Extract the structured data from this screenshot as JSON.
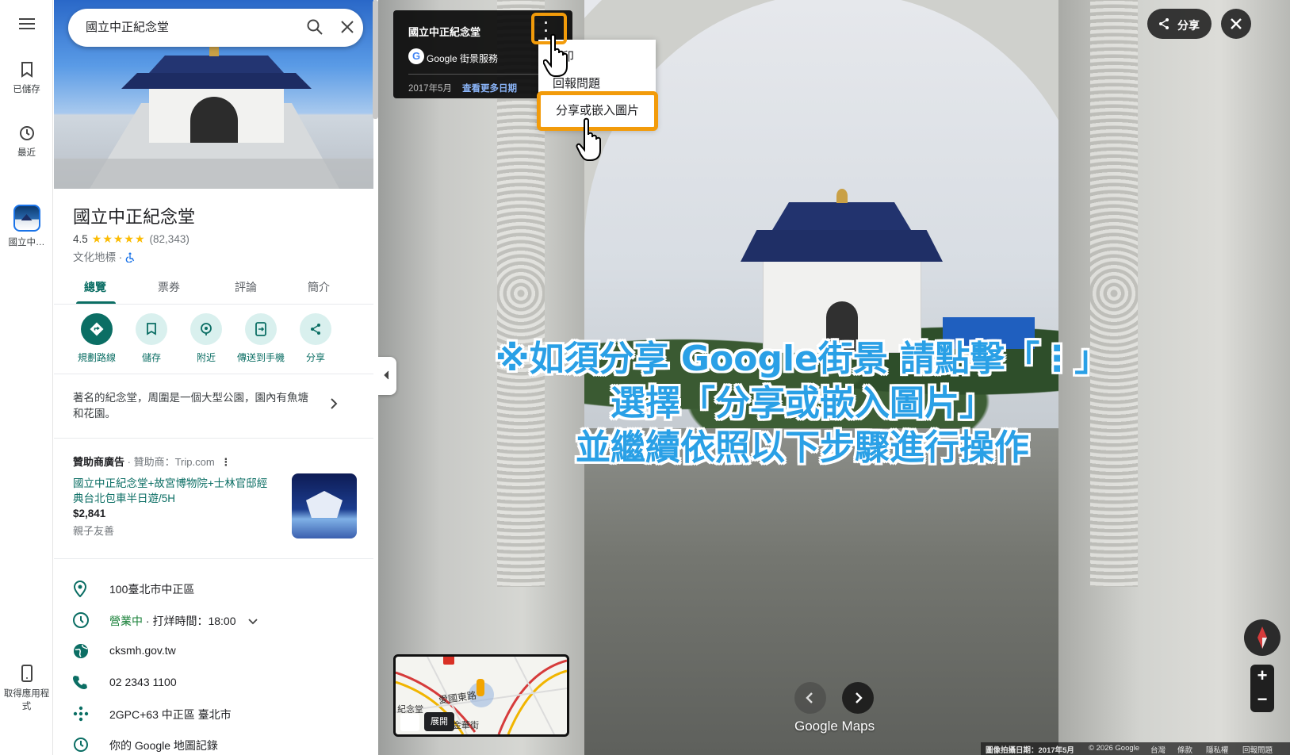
{
  "rail": {
    "menu_label": "",
    "saved_label": "已儲存",
    "recent_label": "最近",
    "place_label": "國立中…",
    "get_app_label": "取得應用程式"
  },
  "search": {
    "value": "國立中正紀念堂"
  },
  "place": {
    "title": "國立中正紀念堂",
    "rating": "4.5",
    "stars": "★★★★★",
    "review_count": "(82,343)",
    "category": "文化地標 · ",
    "accessible_icon": "wheelchair-icon"
  },
  "tabs": [
    {
      "label": "總覽",
      "active": true
    },
    {
      "label": "票券",
      "active": false
    },
    {
      "label": "評論",
      "active": false
    },
    {
      "label": "簡介",
      "active": false
    }
  ],
  "actions": [
    {
      "label": "規劃路線",
      "icon": "directions-icon"
    },
    {
      "label": "儲存",
      "icon": "bookmark-icon"
    },
    {
      "label": "附近",
      "icon": "nearby-icon"
    },
    {
      "label": "傳送到手機",
      "icon": "send-to-phone-icon"
    },
    {
      "label": "分享",
      "icon": "share-icon"
    }
  ],
  "description": "著名的紀念堂，周圍是一個大型公園，園內有魚塘和花園。",
  "sponsored": {
    "heading": "贊助商廣告",
    "sponsor": " · 贊助商：Trip.com",
    "title": "國立中正紀念堂+故宮博物院+士林官邸經典台北包車半日遊/5H",
    "price": "$2,841",
    "tag": "親子友善"
  },
  "info": {
    "address": "100臺北市中正區",
    "status_open": "營業中",
    "status_hours": " · 打烊時間：18:00",
    "website": "cksmh.gov.tw",
    "phone": "02 2343 1100",
    "plus_code": "2GPC+63 中正區 臺北市",
    "history": "你的 Google 地圖記錄"
  },
  "streetview": {
    "card_title": "國立中正紀念堂",
    "card_brand": "Google 街景服務",
    "card_date": "2017年5月",
    "card_more": "查看更多日期",
    "menu_item_1": "印",
    "menu_item_2": "回報問題",
    "menu_item_3": "分享或嵌入圖片",
    "share_label": "分享",
    "overlay_line1": "※如須分享 Google街景 請點擊「⋮」",
    "overlay_line2": "選擇「分享或嵌入圖片」",
    "overlay_line3": "並繼續依照以下步驟進行操作",
    "minimap_label_a": "愛國東路",
    "minimap_label_b": "紀念堂",
    "minimap_label_c": "金華街",
    "expand_label": "展開",
    "google_maps_logo": "Google Maps",
    "zoom_in": "+",
    "zoom_out": "−"
  },
  "footer": {
    "capture_date": "圖像拍攝日期：2017年5月",
    "copyright": "© 2026 Google",
    "region": "台灣",
    "terms": "條款",
    "privacy": "隱私權",
    "report": "回報問題"
  },
  "colors": {
    "accent_teal": "#0b6e64",
    "highlight_orange": "#f29b0a",
    "overlay_blue": "#2aa0e6",
    "star_yellow": "#fbbc04"
  }
}
